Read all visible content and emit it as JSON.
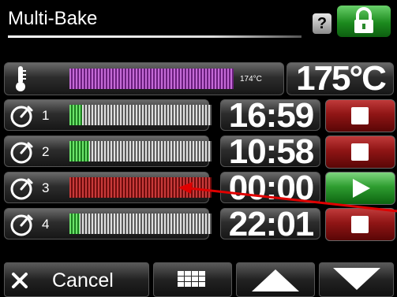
{
  "header": {
    "title": "Multi-Bake",
    "help_label": "?"
  },
  "colors": {
    "stop": "#8f1515",
    "play": "#2e9d30",
    "progress": "#2ec52f",
    "temperature": "#8e2fa3",
    "annotation_arrow": "#e00000"
  },
  "temperature": {
    "icon": "thermometer-icon",
    "current": "174°C",
    "setpoint": "175°C"
  },
  "timers": [
    {
      "number": "1",
      "time": "16:59",
      "action": "stop",
      "progress": 0.09
    },
    {
      "number": "2",
      "time": "10:58",
      "action": "stop",
      "progress": 0.14
    },
    {
      "number": "3",
      "time": "00:00",
      "action": "play",
      "progress": 0
    },
    {
      "number": "4",
      "time": "22:01",
      "action": "stop",
      "progress": 0.07
    }
  ],
  "footer": {
    "cancel_label": "Cancel",
    "icons": [
      "close-icon",
      "keypad-icon",
      "arrow-up-icon",
      "arrow-down-icon"
    ]
  }
}
